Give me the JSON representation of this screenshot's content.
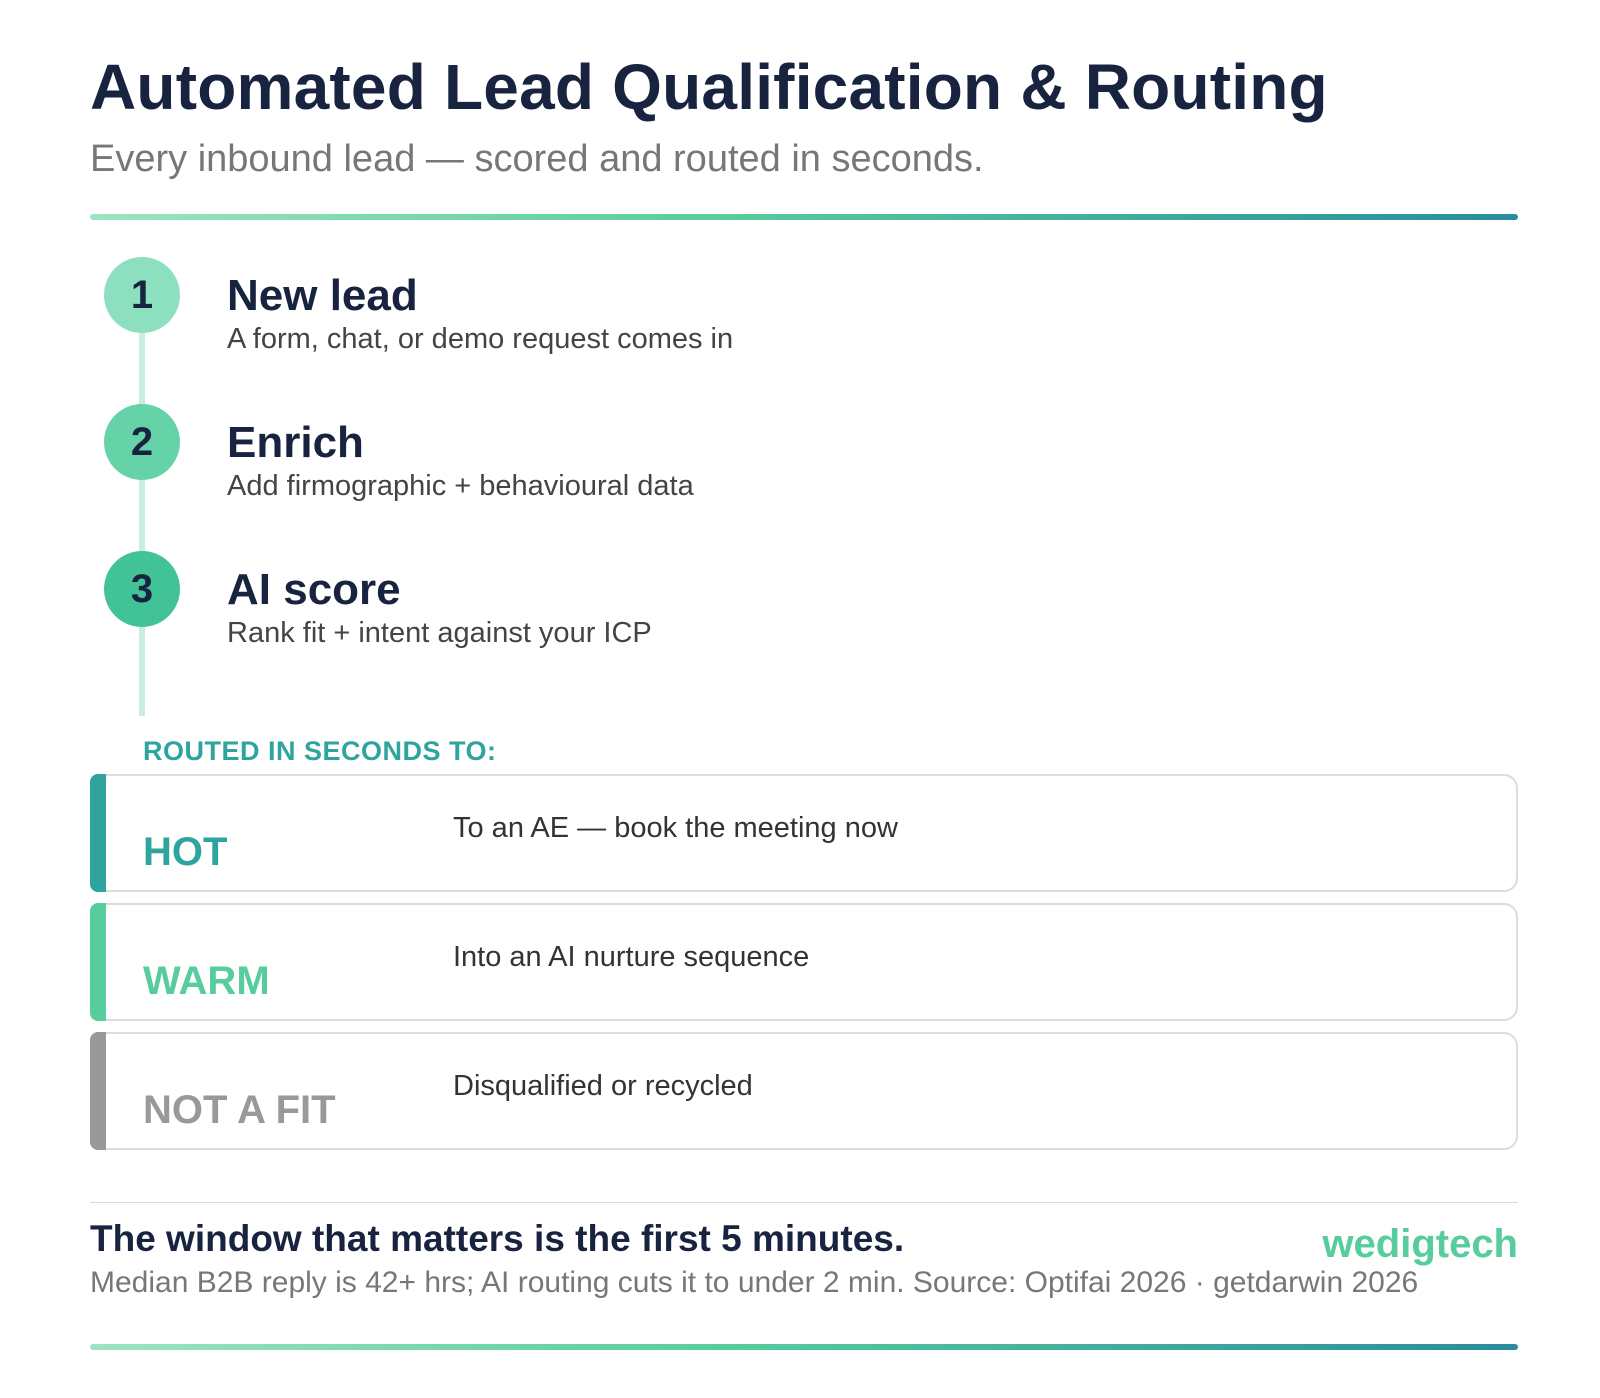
{
  "header": {
    "title": "Automated Lead Qualification & Routing",
    "subtitle": "Every inbound lead — scored and routed in seconds."
  },
  "steps": [
    {
      "number": "1",
      "title": "New lead",
      "description": "A form, chat, or demo request comes in",
      "color": "#8de0bf"
    },
    {
      "number": "2",
      "title": "Enrich",
      "description": "Add firmographic + behavioural data",
      "color": "#66d2a8"
    },
    {
      "number": "3",
      "title": "AI score",
      "description": "Rank fit + intent against your ICP",
      "color": "#42c397"
    }
  ],
  "routing": {
    "label": "ROUTED IN SECONDS TO:",
    "routes": [
      {
        "name": "HOT",
        "description": "To an AE — book the meeting now",
        "color": "#2fa39d"
      },
      {
        "name": "WARM",
        "description": "Into an AI nurture sequence",
        "color": "#57cc9c"
      },
      {
        "name": "NOT A FIT",
        "description": "Disqualified or recycled",
        "color": "#999999"
      }
    ]
  },
  "footer": {
    "headline": "The window that matters is the first 5 minutes.",
    "brand": "wedigtech",
    "note": "Median B2B reply is 42+ hrs; AI routing cuts it to under 2 min. Source: Optifai 2026 · getdarwin 2026"
  }
}
